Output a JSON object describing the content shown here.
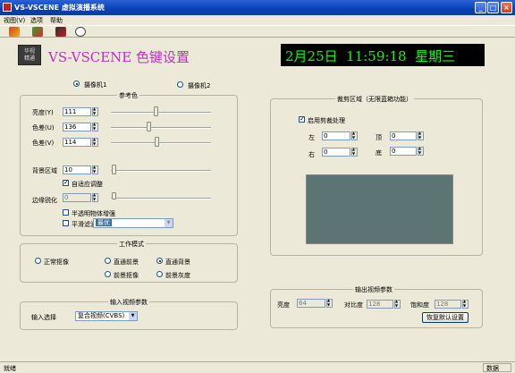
{
  "window": {
    "title": "VS-VSCENE 虚拟演播系统"
  },
  "menu": [
    "视图(V)",
    "选项",
    "帮助"
  ],
  "header": {
    "logo_text": "华视\n精通",
    "app_title": "VS-VSCENE 色键设置",
    "clock": "2月25日  11:59:18  星期三"
  },
  "cameras": {
    "cam1": "摄像机1",
    "cam2": "摄像机2",
    "selected": "cam1"
  },
  "ref_color": {
    "title": "参考色",
    "brightness": {
      "label": "亮度(Y)",
      "value": "111"
    },
    "color_u": {
      "label": "色差(U)",
      "value": "136"
    },
    "color_v": {
      "label": "色差(V)",
      "value": "114"
    },
    "bg_area": {
      "label": "背景区域",
      "value": "10"
    },
    "adaptive": {
      "label": "自适应调整",
      "checked": true
    },
    "edge_sharpen": {
      "label": "边缘锐化",
      "value": "0"
    },
    "translucent": {
      "label": "半透明物体增强",
      "checked": false
    },
    "smooth": {
      "label": "平滑滤波",
      "checked": false,
      "value": "最优"
    }
  },
  "work_mode": {
    "title": "工作模式",
    "options": {
      "normal": "正常抠像",
      "direct_fg": "直通前景",
      "direct_bg": "直通背景",
      "fg_key": "前景抠像",
      "fg_gray": "前景灰度"
    },
    "selected": "direct_bg"
  },
  "input_video": {
    "title": "输入视频参数",
    "select_label": "输入选择",
    "select_value": "复合视频(CVBS)"
  },
  "crop": {
    "title": "裁剪区域（无限蓝箱功能）",
    "enable": {
      "label": "启用剪裁处理",
      "checked": true
    },
    "left": {
      "label": "左",
      "value": "0"
    },
    "top": {
      "label": "顶",
      "value": "0"
    },
    "right": {
      "label": "右",
      "value": "0"
    },
    "bottom": {
      "label": "底",
      "value": "0"
    },
    "preview_color": "#5d7474"
  },
  "output_video": {
    "title": "输出视频参数",
    "brightness": {
      "label": "亮度",
      "value": "64"
    },
    "contrast": {
      "label": "对比度",
      "value": "128"
    },
    "saturation": {
      "label": "饱和度",
      "value": "128"
    },
    "reset_label": "恢复默认设置"
  },
  "status": {
    "left": "就绪",
    "right": "数据"
  },
  "colors": {
    "title_purple": "#c030c0",
    "clock_green": "#00ff00",
    "clock_bg": "#000000"
  }
}
